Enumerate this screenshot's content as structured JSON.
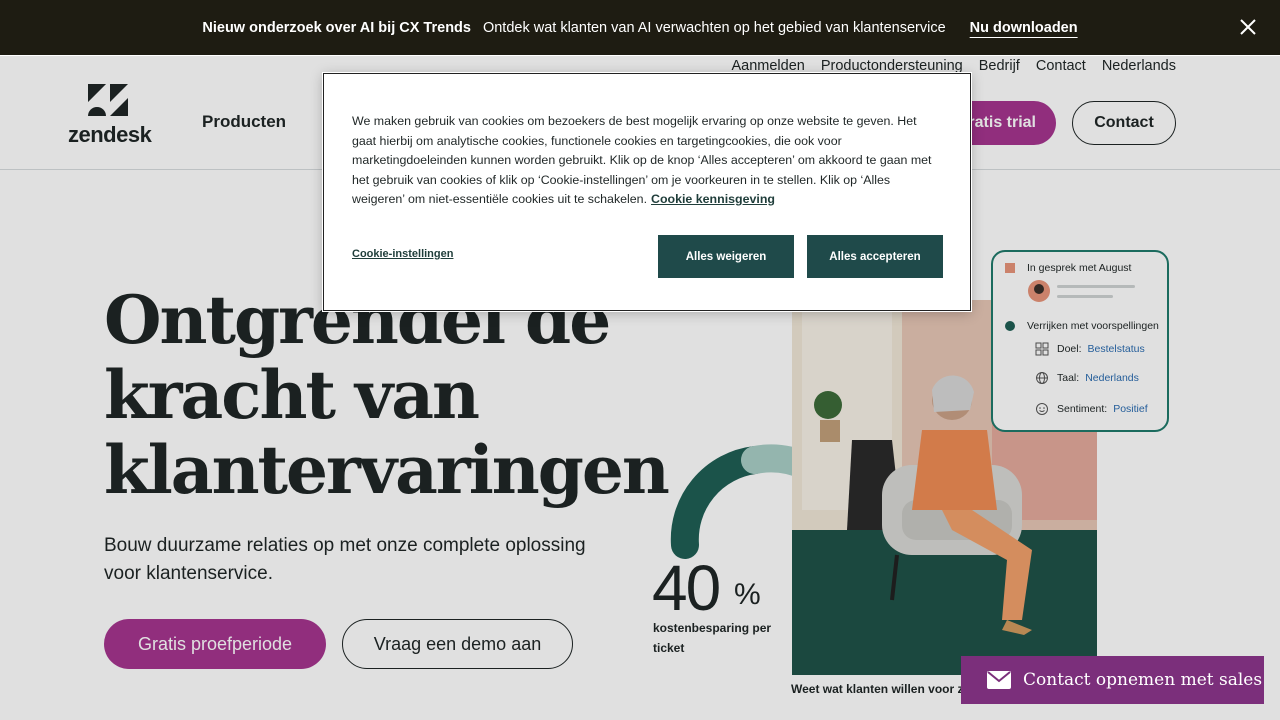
{
  "announcement": {
    "title": "Nieuw onderzoek over AI bij CX Trends",
    "text": "Ontdek wat klanten van AI verwachten op het gebied van klantenservice",
    "link": "Nu downloaden"
  },
  "utility_nav": {
    "items": [
      "Aanmelden",
      "Productondersteuning",
      "Bedrijf",
      "Contact",
      "Nederlands"
    ]
  },
  "header": {
    "logo_text": "zendesk",
    "nav_products": "Producten",
    "trial_button": "Gratis trial",
    "contact_button": "Contact"
  },
  "hero": {
    "title_lines": [
      "Ontgrendel de",
      "kracht van",
      "klantervaringen"
    ],
    "subtitle": "Bouw duurzame relaties op met onze complete oplossing voor klantenservice.",
    "primary_button": "Gratis proefperiode",
    "secondary_button": "Vraag een demo aan"
  },
  "stat": {
    "value": "40",
    "unit": "%",
    "label": "kostenbesparing per ticket"
  },
  "photo": {
    "caption": "Weet wat klanten willen voor ze het vragen"
  },
  "insight_card": {
    "conversation": "In gesprek met August",
    "enrich": "Verrijken met voorspellingen",
    "rows": [
      {
        "key": "Doel:",
        "value": "Bestelstatus",
        "icon": "grid-icon"
      },
      {
        "key": "Taal:",
        "value": "Nederlands",
        "icon": "globe-icon"
      },
      {
        "key": "Sentiment:",
        "value": "Positief",
        "icon": "smiley-icon"
      }
    ]
  },
  "cookie_dialog": {
    "text": "We maken gebruik van cookies om bezoekers de best mogelijk ervaring op onze website te geven. Het gaat hierbij om analytische cookies, functionele cookies en targetingcookies, die ook voor marketingdoeleinden kunnen worden gebruikt. Klik op de knop ‘Alles accepteren’ om akkoord te gaan met het gebruik van cookies of klik op ‘Cookie-instellingen’ om je voorkeuren in te stellen. Klik op ‘Alles weigeren’ om niet-essentiële cookies uit te schakelen.",
    "notice_link": "Cookie kennisgeving",
    "settings": "Cookie-instellingen",
    "reject": "Alles weigeren",
    "accept": "Alles accepteren"
  },
  "sales_widget": {
    "label": "Contact opnemen met sales"
  },
  "colors": {
    "brand_purple": "#a5358f",
    "dark_teal": "#1f4a4a",
    "announce_bg": "#1e1c12"
  }
}
